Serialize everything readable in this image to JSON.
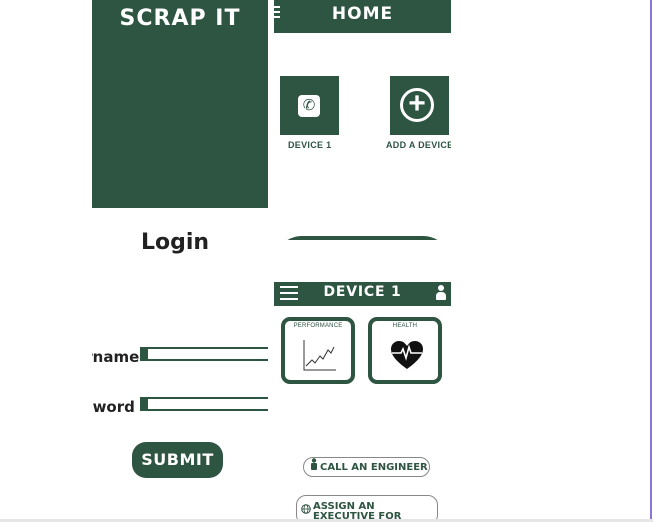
{
  "login": {
    "brand": "SCRAP IT",
    "title": "Login",
    "username_label": "Username",
    "password_label": "Password",
    "submit_label": "SUBMIT"
  },
  "home": {
    "title": "HOME",
    "tiles": [
      {
        "label": "DEVICE 1",
        "icon": "phone-icon"
      },
      {
        "label": "ADD A DEVICE",
        "icon": "add-circle-icon"
      }
    ]
  },
  "device": {
    "title": "DEVICE 1",
    "cards": [
      {
        "label": "PERFORMANCE",
        "icon": "line-chart-icon"
      },
      {
        "label": "HEALTH",
        "icon": "heart-pulse-icon"
      }
    ],
    "actions": [
      {
        "label": "CALL AN ENGINEER",
        "icon": "engineer-icon"
      },
      {
        "label": "ASSIGN AN EXECUTIVE FOR PICK-UP",
        "icon": "globe-icon"
      }
    ]
  },
  "colors": {
    "brand_green": "#2e5442",
    "divider": "#8a74d6"
  }
}
